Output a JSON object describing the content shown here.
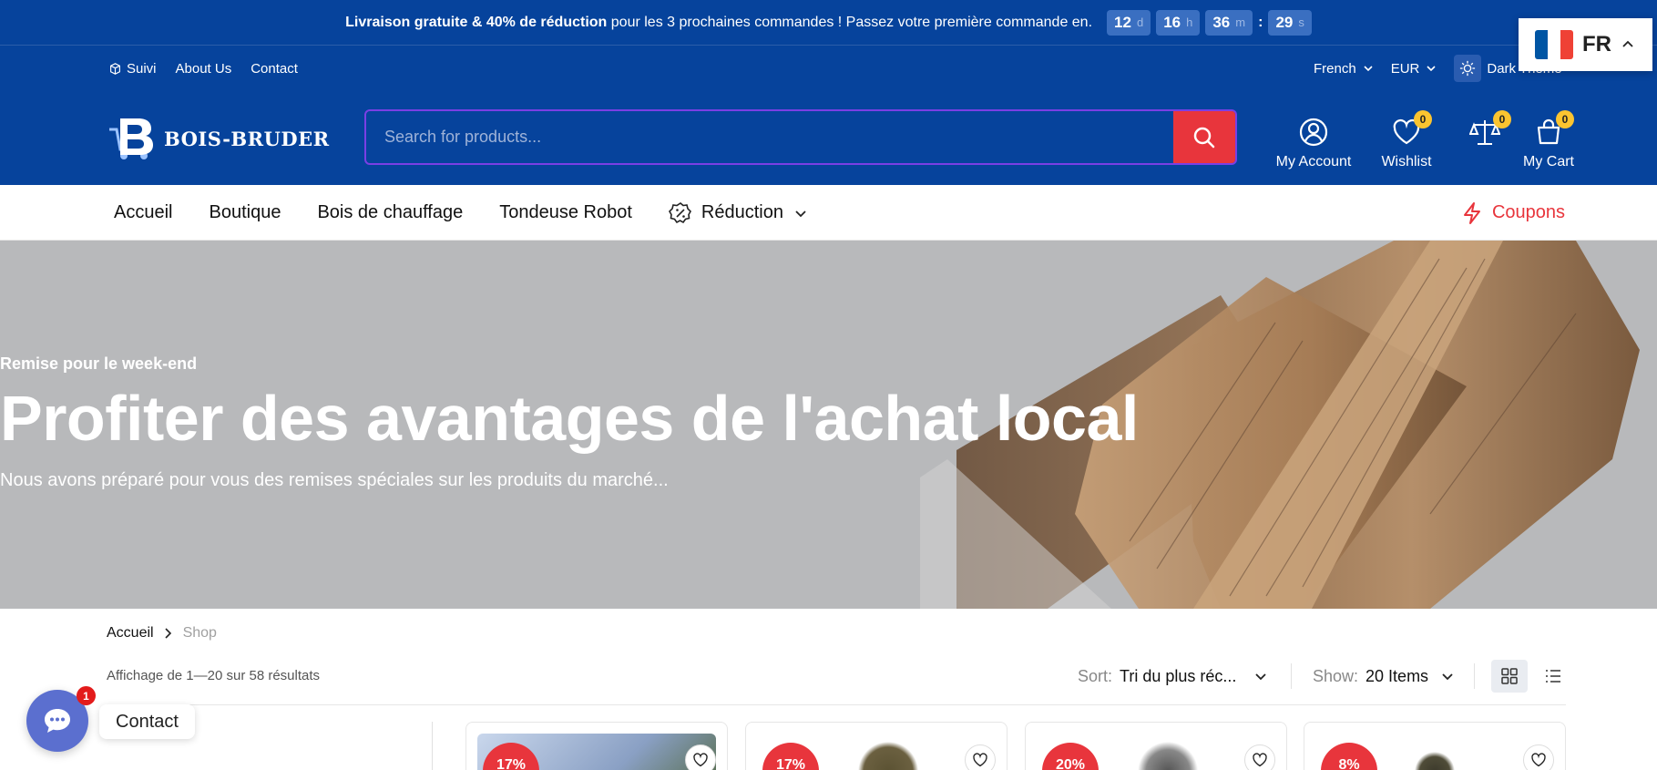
{
  "promo": {
    "bold": "Livraison gratuite & 40% de réduction",
    "rest": "pour les 3 prochaines commandes ! Passez votre première commande en.",
    "countdown": [
      {
        "value": "12",
        "unit": "d"
      },
      {
        "value": "16",
        "unit": "h"
      },
      {
        "value": "36",
        "unit": "m"
      },
      {
        "value": "29",
        "unit": "s"
      }
    ],
    "separator": ":"
  },
  "topbar": {
    "links": [
      "Suivi",
      "About Us",
      "Contact"
    ],
    "language": "French",
    "currency": "EUR",
    "theme": "Dark Theme"
  },
  "lang_widget": {
    "code": "FR",
    "flag_colors": [
      "#0055a4",
      "#ffffff",
      "#ef4135"
    ]
  },
  "header": {
    "logo_text": "BOIS-BRUDER",
    "search_placeholder": "Search for products...",
    "account_label": "My Account",
    "wishlist_label": "Wishlist",
    "wishlist_count": "0",
    "compare_count": "0",
    "cart_label": "My Cart",
    "cart_count": "0"
  },
  "nav": {
    "items": [
      "Accueil",
      "Boutique",
      "Bois de chauffage",
      "Tondeuse Robot",
      "Réduction"
    ],
    "coupons": "Coupons"
  },
  "hero": {
    "kicker": "Remise pour le week-end",
    "title": "Profiter des avantages de l'achat local",
    "subtitle": "Nous avons préparé pour vous des remises spéciales sur les produits du marché..."
  },
  "breadcrumb": {
    "home": "Accueil",
    "current": "Shop"
  },
  "listing": {
    "results": "Affichage de 1—20 sur 58 résultats",
    "sort_label": "Sort:",
    "sort_value": "Tri du plus réc...",
    "show_label": "Show:",
    "show_value": "20 Items"
  },
  "products": [
    {
      "discount": "17%"
    },
    {
      "discount": "17%"
    },
    {
      "discount": "20%"
    },
    {
      "discount": "8%"
    }
  ],
  "chat": {
    "label": "Contact",
    "count": "1"
  },
  "colors": {
    "brand": "#06439c",
    "accent": "#e8353c",
    "badge": "#fbc430"
  }
}
